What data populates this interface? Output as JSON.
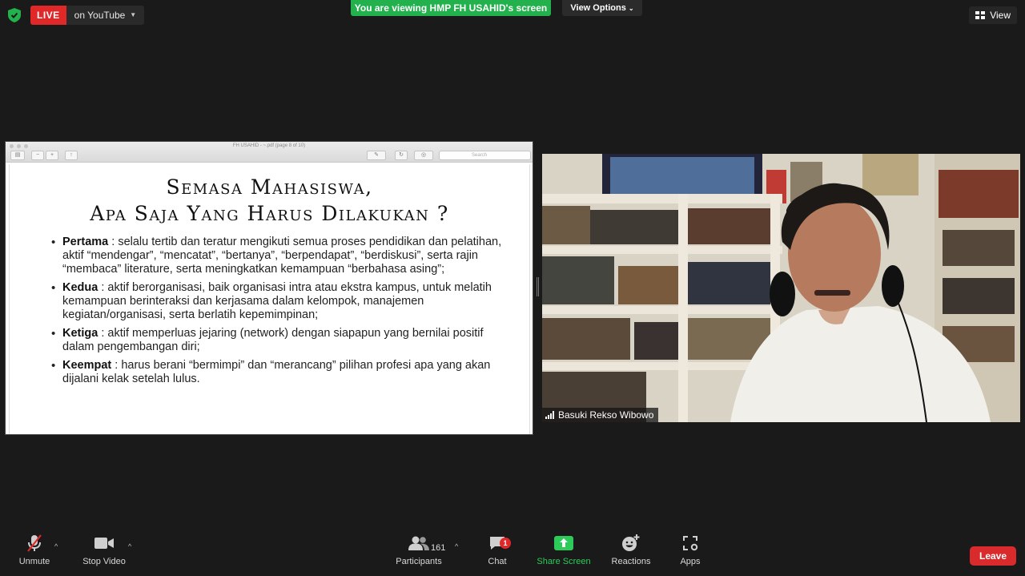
{
  "top_bar": {
    "live_badge": "LIVE",
    "live_destination": "on YouTube",
    "viewing_banner": "You are viewing HMP FH USAHID's screen",
    "view_options": "View Options",
    "view_button": "View"
  },
  "shared_screen": {
    "window_title": "FH USAHID - ~.pdf (page 8 of 10)",
    "search_placeholder": "Search",
    "slide": {
      "title_line1": "Semasa Mahasiswa,",
      "title_line2": "Apa Saja Yang Harus Dilakukan ?",
      "bullets": [
        {
          "term": "Pertama",
          "text": " : selalu tertib dan teratur  mengikuti semua proses pendidikan dan pelatihan,  aktif “mendengar”, “mencatat”, “bertanya”, “berpendapat”, “berdiskusi”, serta rajin “membaca” literature, serta meningkatkan kemampuan “berbahasa asing”;"
        },
        {
          "term": "Kedua",
          "text": " : aktif berorganisasi, baik organisasi intra atau ekstra kampus,  untuk melatih kemampuan berinteraksi dan kerjasama dalam kelompok, manajemen kegiatan/organisasi, serta berlatih kepemimpinan;"
        },
        {
          "term": "Ketiga",
          "text": " : aktif memperluas jejaring (network) dengan siapapun yang bernilai positif dalam pengembangan diri;"
        },
        {
          "term": "Keempat",
          "text": " :  harus berani “bermimpi” dan “merancang”  pilihan profesi apa yang akan dijalani kelak setelah lulus."
        }
      ]
    }
  },
  "participant_video": {
    "name": "Basuki Rekso Wibowo"
  },
  "toolbar": {
    "unmute": "Unmute",
    "stop_video": "Stop Video",
    "participants": "Participants",
    "participants_count": "161",
    "chat": "Chat",
    "chat_badge": "1",
    "share_screen": "Share Screen",
    "reactions": "Reactions",
    "apps": "Apps",
    "leave": "Leave"
  },
  "colors": {
    "live_red": "#e02828",
    "banner_green": "#23b14d",
    "share_green": "#2dcb5a",
    "leave_red": "#d92b2b"
  }
}
